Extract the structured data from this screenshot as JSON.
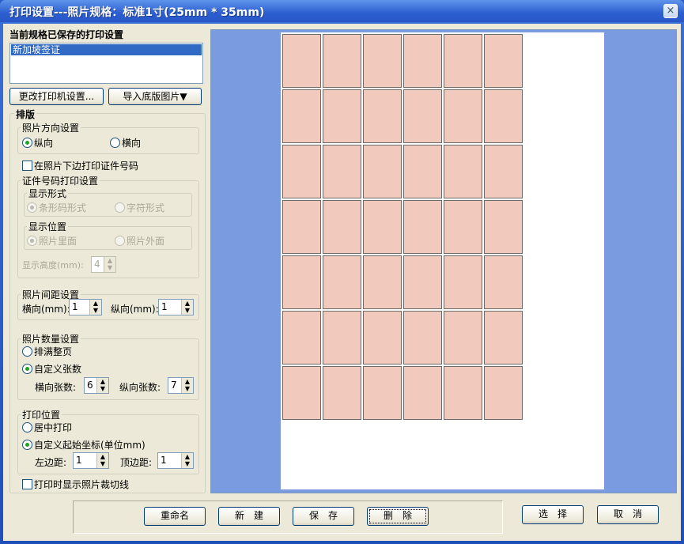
{
  "window": {
    "title": "打印设置---照片规格：标准1寸(25mm * 35mm)",
    "close_glyph": "×"
  },
  "saved": {
    "heading": "当前规格已保存的打印设置",
    "items": [
      "新加坡签证"
    ]
  },
  "buttons": {
    "printer_settings": "更改打印机设置...",
    "import_bg": "导入底版图片▼"
  },
  "layout": {
    "section": "排版",
    "orientation": {
      "title": "照片方向设置",
      "portrait": "纵向",
      "landscape": "横向",
      "selected": "portrait"
    },
    "print_id_label": "在照片下边打印证件号码",
    "id_settings": {
      "title": "证件号码打印设置",
      "display_form": {
        "title": "显示形式",
        "barcode": "条形码形式",
        "text": "字符形式"
      },
      "display_pos": {
        "title": "显示位置",
        "inside": "照片里面",
        "outside": "照片外面"
      },
      "height_label": "显示高度(mm):",
      "height_value": "4"
    },
    "spacing": {
      "title": "照片间距设置",
      "h_label": "横向(mm):",
      "h_value": "1",
      "v_label": "纵向(mm):",
      "v_value": "1"
    },
    "count": {
      "title": "照片数量设置",
      "fill_page": "排满整页",
      "custom": "自定义张数",
      "h_label": "横向张数:",
      "h_value": "6",
      "v_label": "纵向张数:",
      "v_value": "7"
    },
    "position": {
      "title": "打印位置",
      "center": "居中打印",
      "custom": "自定义起始坐标(单位mm)",
      "left_label": "左边距:",
      "left_value": "1",
      "top_label": "顶边距:",
      "top_value": "1"
    },
    "cutline_label": "打印时显示照片裁切线"
  },
  "preview": {
    "columns": 6,
    "rows": 7,
    "photo_color": "#f2cabd",
    "bg_color": "#7b9be0"
  },
  "footer": {
    "rename": "重命名",
    "new": "新　建",
    "save": "保　存",
    "delete": "删　除",
    "select": "选　择",
    "cancel": "取　消"
  }
}
